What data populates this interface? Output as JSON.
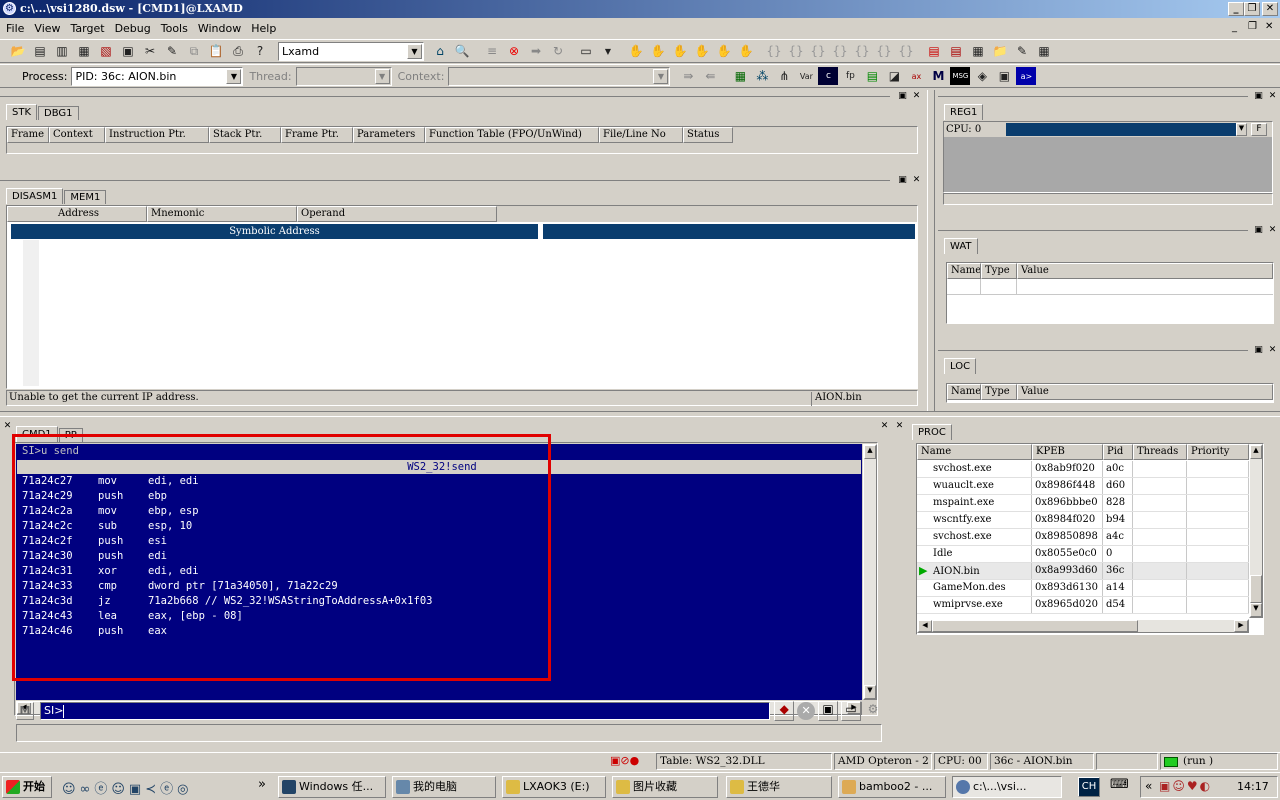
{
  "window": {
    "title": "c:\\...\\vsi1280.dsw - [CMD1]@LXAMD"
  },
  "menu": [
    "File",
    "View",
    "Target",
    "Debug",
    "Tools",
    "Window",
    "Help"
  ],
  "toolbar": {
    "target_combo": "Lxamd",
    "process_label": "Process:",
    "process_value": "PID: 36c: AION.bin",
    "thread_label": "Thread:",
    "thread_value": "",
    "context_label": "Context:",
    "context_value": ""
  },
  "stk": {
    "tabs": [
      "STK",
      "DBG1"
    ],
    "columns": [
      "Frame",
      "Context",
      "Instruction Ptr.",
      "Stack Ptr.",
      "Frame Ptr.",
      "Parameters",
      "Function Table (FPO/UnWind)",
      "File/Line No",
      "Status"
    ]
  },
  "reg": {
    "tab": "REG1",
    "cpu_label": "CPU: 0",
    "f_button": "F"
  },
  "wat": {
    "tab": "WAT",
    "columns": [
      "Name",
      "Type",
      "Value"
    ]
  },
  "loc": {
    "tab": "LOC",
    "columns": [
      "Name",
      "Type",
      "Value"
    ]
  },
  "disasm": {
    "tabs": [
      "DISASM1",
      "MEM1"
    ],
    "columns": [
      "Address",
      "Mnemonic",
      "Operand"
    ],
    "symbolic_header": "Symbolic Address",
    "status_message": "Unable to get the current IP address.",
    "status_module": "AION.bin"
  },
  "cmd": {
    "tabs": [
      "CMD1",
      "PP"
    ],
    "command": "SI>u send",
    "symbol_header": "WS2_32!send",
    "lines": [
      {
        "addr": "71a24c27",
        "mn": "mov",
        "op": "edi, edi"
      },
      {
        "addr": "71a24c29",
        "mn": "push",
        "op": "ebp"
      },
      {
        "addr": "71a24c2a",
        "mn": "mov",
        "op": "ebp, esp"
      },
      {
        "addr": "71a24c2c",
        "mn": "sub",
        "op": "esp, 10"
      },
      {
        "addr": "71a24c2f",
        "mn": "push",
        "op": "esi"
      },
      {
        "addr": "71a24c30",
        "mn": "push",
        "op": "edi"
      },
      {
        "addr": "71a24c31",
        "mn": "xor",
        "op": "edi, edi"
      },
      {
        "addr": "71a24c33",
        "mn": "cmp",
        "op": "dword ptr [71a34050], 71a22c29"
      },
      {
        "addr": "71a24c3d",
        "mn": "jz",
        "op": "71a2b668 // WS2_32!WSAStringToAddressA+0x1f03"
      },
      {
        "addr": "71a24c43",
        "mn": "lea",
        "op": "eax, [ebp - 08]"
      },
      {
        "addr": "71a24c46",
        "mn": "push",
        "op": "eax"
      }
    ],
    "input_value": "SI>"
  },
  "proc": {
    "tab": "PROC",
    "columns": [
      "Name",
      "KPEB",
      "Pid",
      "Threads",
      "Priority"
    ],
    "rows": [
      {
        "name": "svchost.exe",
        "kpeb": "0x8ab9f020",
        "pid": "a0c",
        "current": false
      },
      {
        "name": "wuauclt.exe",
        "kpeb": "0x8986f448",
        "pid": "d60",
        "current": false
      },
      {
        "name": "mspaint.exe",
        "kpeb": "0x896bbbe0",
        "pid": "828",
        "current": false
      },
      {
        "name": "wscntfy.exe",
        "kpeb": "0x8984f020",
        "pid": "b94",
        "current": false
      },
      {
        "name": "svchost.exe",
        "kpeb": "0x89850898",
        "pid": "a4c",
        "current": false
      },
      {
        "name": "Idle",
        "kpeb": "0x8055e0c0",
        "pid": "0",
        "current": false
      },
      {
        "name": "AION.bin",
        "kpeb": "0x8a993d60",
        "pid": "36c",
        "current": true
      },
      {
        "name": "GameMon.des",
        "kpeb": "0x893d6130",
        "pid": "a14",
        "current": false
      },
      {
        "name": "wmiprvse.exe",
        "kpeb": "0x8965d020",
        "pid": "d54",
        "current": false
      }
    ]
  },
  "statusbar": {
    "table": "Table: WS2_32.DLL",
    "cpu_model": "AMD Opteron - 2",
    "cpu": "CPU: 00",
    "process": "36c - AION.bin",
    "state": "(run )"
  },
  "taskbar": {
    "start": "开始",
    "tasks": [
      "Windows 任...",
      "我的电脑",
      "LXAOK3 (E:)",
      "图片收藏",
      "王德华",
      "bamboo2 - ...",
      "c:\\...\\vsi..."
    ],
    "lang": "CH",
    "time": "14:17",
    "chevron": "»",
    "tray_chevron": "«"
  },
  "colors": {
    "accent_blue": "#000080",
    "title_blue": "#0a246a",
    "highlight_red": "#e00000",
    "face": "#d4d0c8"
  }
}
